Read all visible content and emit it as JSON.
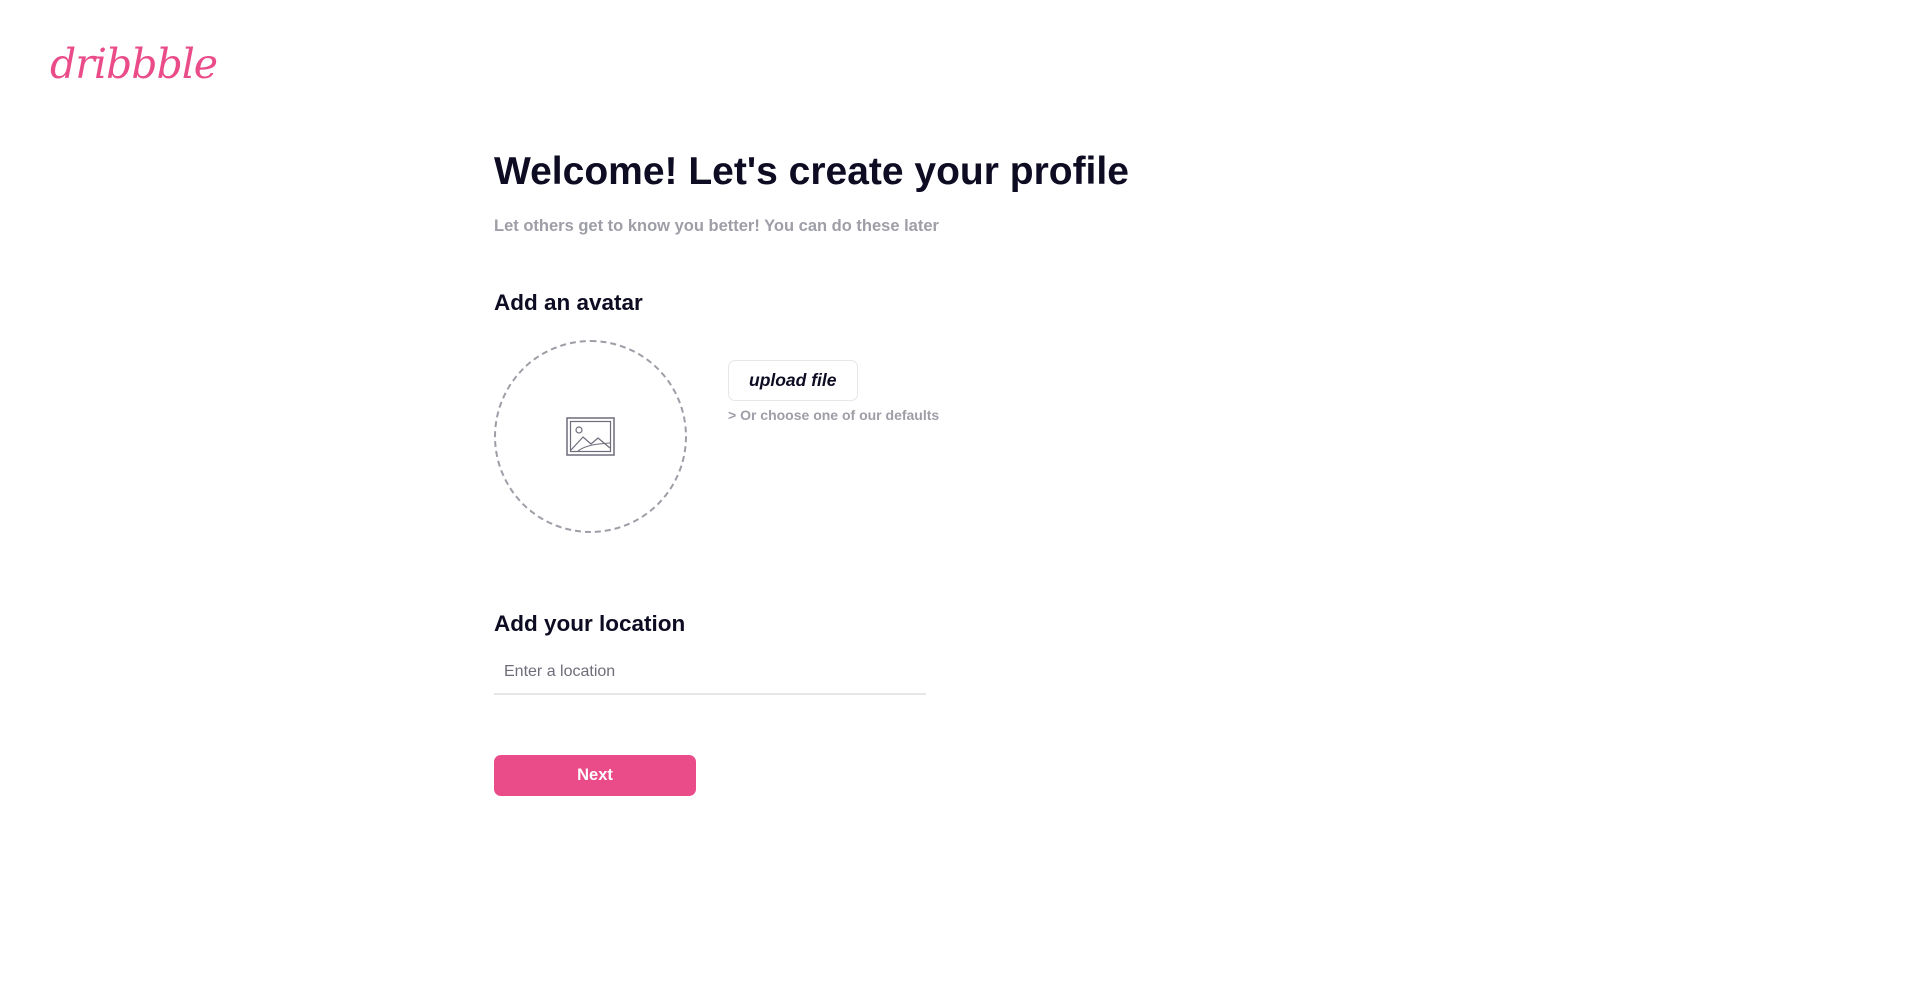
{
  "brand": {
    "logo_text": "dribbble",
    "accent_color": "#ea4c89"
  },
  "header": {
    "title": "Welcome! Let's create your profile",
    "subtitle": "Let others get to know you better! You can do these later"
  },
  "avatar_section": {
    "heading": "Add an avatar",
    "placeholder_icon": "image-icon",
    "upload_label": "upload file",
    "defaults_link": "> Or choose one of our defaults"
  },
  "location_section": {
    "heading": "Add your location",
    "input_value": "",
    "input_placeholder": "Enter a location"
  },
  "actions": {
    "next_label": "Next"
  }
}
